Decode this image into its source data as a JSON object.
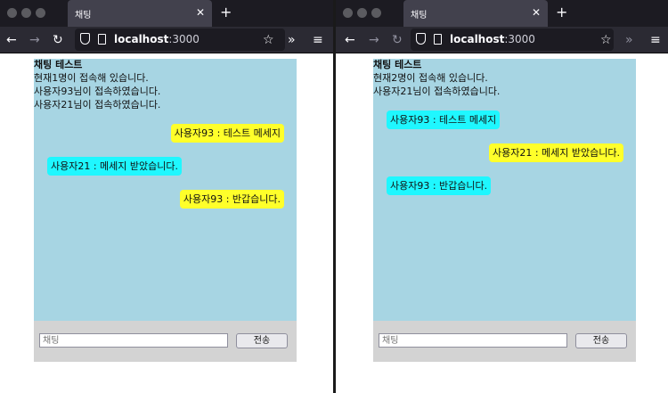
{
  "windows": [
    {
      "tab_title": "채팅",
      "url_host": "localhost",
      "url_port": ":3000",
      "app": {
        "title": "채팅 테스트",
        "system_messages": [
          "현재1명이 접속해 있습니다.",
          "사용자93님이 접속하였습니다.",
          "사용자21님이 접속하였습니다."
        ],
        "messages": [
          {
            "text": "사용자93 : 테스트 메세지",
            "kind": "mine"
          },
          {
            "text": "사용자21 : 메세지 받았습니다.",
            "kind": "other"
          },
          {
            "text": "사용자93 : 반갑습니다.",
            "kind": "mine"
          }
        ],
        "input_placeholder": "채팅",
        "send_label": "전송"
      }
    },
    {
      "tab_title": "채팅",
      "url_host": "localhost",
      "url_port": ":3000",
      "app": {
        "title": "채팅 테스트",
        "system_messages": [
          "현재2명이 접속해 있습니다.",
          "사용자21님이 접속하였습니다."
        ],
        "messages": [
          {
            "text": "사용자93 : 테스트 메세지",
            "kind": "other"
          },
          {
            "text": "사용자21 : 메세지 받았습니다.",
            "kind": "mine"
          },
          {
            "text": "사용자93 : 반갑습니다.",
            "kind": "other"
          }
        ],
        "input_placeholder": "채팅",
        "send_label": "전송"
      }
    }
  ],
  "icons": {
    "back": "←",
    "forward": "→",
    "reload": "↻",
    "bookmark": "☆",
    "overflow": "»",
    "menu": "≡",
    "close": "✕",
    "new_tab": "+"
  },
  "colors": {
    "chat_background": "#a7d5e3",
    "input_bar_background": "#d3d3d3",
    "own_bubble": "#ffff2a",
    "other_bubble": "#1ff7ff"
  }
}
